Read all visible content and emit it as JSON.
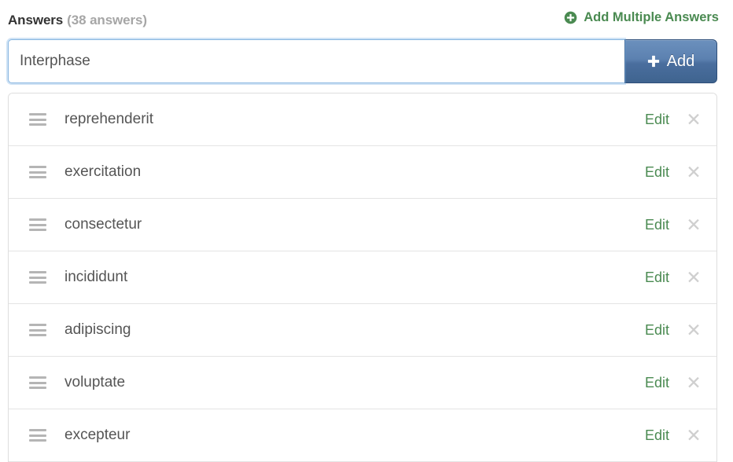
{
  "header": {
    "title": "Answers",
    "count_label": "(38 answers)",
    "add_multiple_label": "Add Multiple Answers",
    "add_multiple_icon": "plus-circle-icon"
  },
  "input": {
    "value": "Interphase",
    "placeholder": "",
    "add_button_label": "Add",
    "add_button_icon": "plus-icon"
  },
  "list": {
    "row_edit_label": "Edit",
    "row_delete_icon": "close-icon",
    "row_drag_icon": "drag-handle-icon",
    "items": [
      {
        "text": "reprehenderit"
      },
      {
        "text": "exercitation"
      },
      {
        "text": "consectetur"
      },
      {
        "text": "incididunt"
      },
      {
        "text": "adipiscing"
      },
      {
        "text": "voluptate"
      },
      {
        "text": "excepteur"
      }
    ]
  },
  "colors": {
    "green_link": "#4a8a51",
    "button_blue": "#4a6e9e",
    "focus_blue": "#87b6e0",
    "text_gray": "#555555",
    "muted_gray": "#a6a6a6",
    "border_gray": "#dedede"
  }
}
